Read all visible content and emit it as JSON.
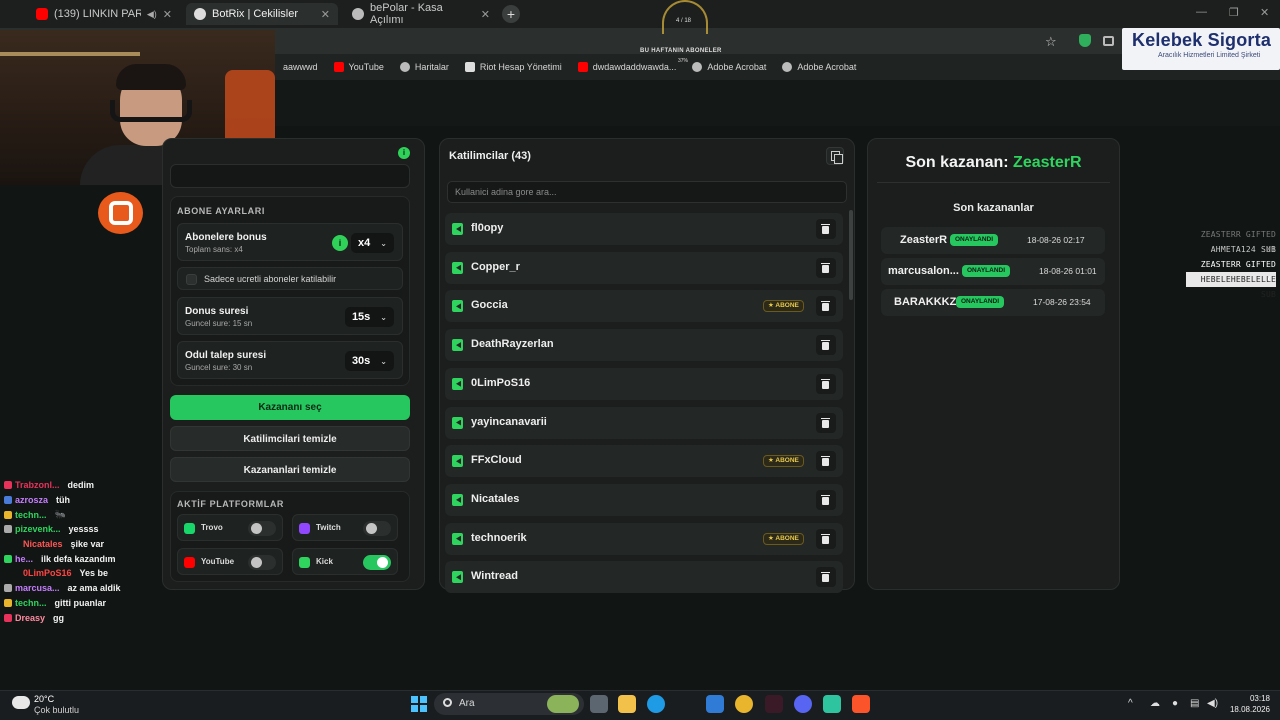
{
  "browser": {
    "tabs": [
      {
        "label": "(139) LINKIN PARK - GREAT",
        "active": false
      },
      {
        "label": "BotRix | Cekilisler",
        "active": true
      },
      {
        "label": "bePolar - Kasa Açılımı",
        "active": false
      }
    ],
    "bookmarks": [
      "aawwwd",
      "YouTube",
      "Haritalar",
      "Riot Hesap Yönetimi",
      "dwdawdaddwawda...",
      "Adobe Acrobat",
      "Adobe Acrobat"
    ]
  },
  "overlay": {
    "title": "BU HAFTANIN ABONELER",
    "percent": "37%",
    "progress": "4 / 18"
  },
  "sponsor": {
    "name": "Kelebek Sigorta",
    "tagline": "Aracılık Hizmetleri Limited Şirketi"
  },
  "settings": {
    "section_title": "ABONE AYARLARI",
    "bonus": {
      "title": "Abonelere bonus",
      "sub": "Toplam sans: x4",
      "value": "x4"
    },
    "paid_only_label": "Sadece ucretli aboneler katilabilir",
    "duration": {
      "title": "Donus suresi",
      "sub": "Guncel sure: 15 sn",
      "value": "15s"
    },
    "claim": {
      "title": "Odul talep suresi",
      "sub": "Guncel sure: 30 sn",
      "value": "30s"
    },
    "pick_winner": "Kazananı seç",
    "clear_participants": "Katilimcilari temizle",
    "clear_winners": "Kazananlari temizle",
    "platforms_title": "AKTİF PLATFORMLAR",
    "platforms": [
      {
        "name": "Trovo",
        "enabled": false,
        "color": "#19d66b"
      },
      {
        "name": "Twitch",
        "enabled": false,
        "color": "#9146ff"
      },
      {
        "name": "YouTube",
        "enabled": false,
        "color": "#ff0000"
      },
      {
        "name": "Kick",
        "enabled": true,
        "color": "#53fc18"
      }
    ]
  },
  "participants": {
    "title": "Katilimcilar (43)",
    "search_placeholder": "Kullanici adina gore ara...",
    "badge_label": "ABONE",
    "list": [
      {
        "name": "fl0opy",
        "sub": false
      },
      {
        "name": "Copper_r",
        "sub": false
      },
      {
        "name": "Goccia",
        "sub": true
      },
      {
        "name": "DeathRayzerlan",
        "sub": false
      },
      {
        "name": "0LimPoS16",
        "sub": false
      },
      {
        "name": "yayincanavarii",
        "sub": false
      },
      {
        "name": "FFxCloud",
        "sub": true
      },
      {
        "name": "Nicatales",
        "sub": false
      },
      {
        "name": "technoerik",
        "sub": true
      },
      {
        "name": "Wintread",
        "sub": false
      }
    ]
  },
  "winners": {
    "last_label": "Son kazanan:",
    "last_name": "ZeasterR",
    "list_title": "Son kazananlar",
    "status_label": "ONAYLANDI",
    "list": [
      {
        "name": "ZeasterR",
        "time": "18-08-26 02:17"
      },
      {
        "name": "marcusalon...",
        "time": "18-08-26 01:01"
      },
      {
        "name": "BARAKKKZ",
        "time": "17-08-26 23:54"
      }
    ]
  },
  "alerts": [
    {
      "text": "ZEASTERR GIFTED X1",
      "color": "#777777"
    },
    {
      "text": "AHMETA124 SUB",
      "color": "#c8c8c8"
    },
    {
      "text": "ZEASTERR GIFTED X1",
      "color": "#ffffff"
    },
    {
      "text": "HEBELEHEBELELLE SUB",
      "color": "#ffffff"
    }
  ],
  "chat": [
    {
      "user": "Trabzonl...",
      "msg": "dedim",
      "color": "#e8315b",
      "badge": "#e8315b"
    },
    {
      "user": "azrosza",
      "msg": "tüh",
      "color": "#c77dff",
      "badge": "#4a7bd8"
    },
    {
      "user": "techn...",
      "msg": "🐜",
      "color": "#2fd45e",
      "badge": "#e8b52c"
    },
    {
      "user": "pizevenk...",
      "msg": "yessss",
      "color": "#2fd45e",
      "badge": "#aaaaaa"
    },
    {
      "user": "Nicatales",
      "msg": "şike var",
      "color": "#ff5555",
      "badge": ""
    },
    {
      "user": "he...",
      "msg": "ilk defa kazandım",
      "color": "#c77dff",
      "badge": "#2fd45e"
    },
    {
      "user": "0LimPoS16",
      "msg": "Yes be",
      "color": "#ff4444",
      "badge": ""
    },
    {
      "user": "marcusa...",
      "msg": "az ama aldik",
      "color": "#c77dff",
      "badge": "#aaaaaa"
    },
    {
      "user": "techn...",
      "msg": "gitti puanlar",
      "color": "#2fd45e",
      "badge": "#e8b52c"
    },
    {
      "user": "Dreasy",
      "msg": "gg",
      "color": "#ff8aa0",
      "badge": "#e8315b"
    }
  ],
  "taskbar": {
    "temp": "20°C",
    "weather": "Çok bulutlu",
    "search_label": "Ara",
    "time": "03:18",
    "date": "18.08.2026"
  }
}
